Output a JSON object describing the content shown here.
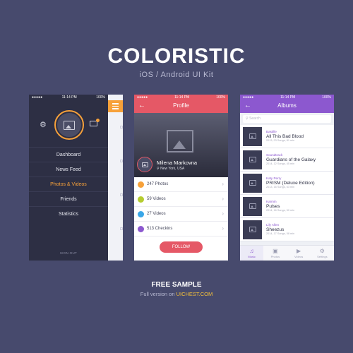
{
  "header": {
    "title": "COLORISTIC",
    "subtitle": "iOS / Android UI Kit"
  },
  "statusbar": {
    "time": "11:14 PM",
    "battery": "100%"
  },
  "phone1": {
    "menu": [
      "Dashboard",
      "News Feed",
      "Photos & Videos",
      "Friends",
      "Statistics"
    ],
    "active_index": 2,
    "signout": "SIGN OUT",
    "accent": "#f7a13a"
  },
  "phone2": {
    "title": "Profile",
    "name": "Milena Markovna",
    "location": "New York, USA",
    "stats": [
      {
        "label": "247 Photos",
        "color": "#f7a13a"
      },
      {
        "label": "59 Videos",
        "color": "#b5cc2f"
      },
      {
        "label": "27 Videos",
        "color": "#3aa7e8"
      },
      {
        "label": "513 Checkins",
        "color": "#8c58cf"
      }
    ],
    "follow": "FOLLOW",
    "accent": "#e55866"
  },
  "phone3": {
    "title": "Albums",
    "search_placeholder": "Search",
    "albums": [
      {
        "artist": "Bastille",
        "album": "All This Bad Blood",
        "meta": "2013, 23 Songs, 81 min"
      },
      {
        "artist": "Soundtrack",
        "album": "Guardians of the Galaxy",
        "meta": "2014, 12 Songs, 45 min"
      },
      {
        "artist": "Katy Perry",
        "album": "PRISM (Deluxe Edition)",
        "meta": "2013, 16 Songs, 63 min"
      },
      {
        "artist": "Karmin",
        "album": "Pulses",
        "meta": "2014, 16 Songs, 50 min"
      },
      {
        "artist": "Lily Allen",
        "album": "Sheezus",
        "meta": "2014, 17 Songs, 58 min"
      }
    ],
    "tabs": [
      {
        "label": "Music",
        "icon": "♫"
      },
      {
        "label": "Photos",
        "icon": "▣"
      },
      {
        "label": "Videos",
        "icon": "▶"
      },
      {
        "label": "Settings",
        "icon": "⚙"
      }
    ],
    "accent": "#8c58cf"
  },
  "footer": {
    "free": "FREE SAMPLE",
    "full_prefix": "Full version on ",
    "full_brand": "UICHEST.COM"
  }
}
